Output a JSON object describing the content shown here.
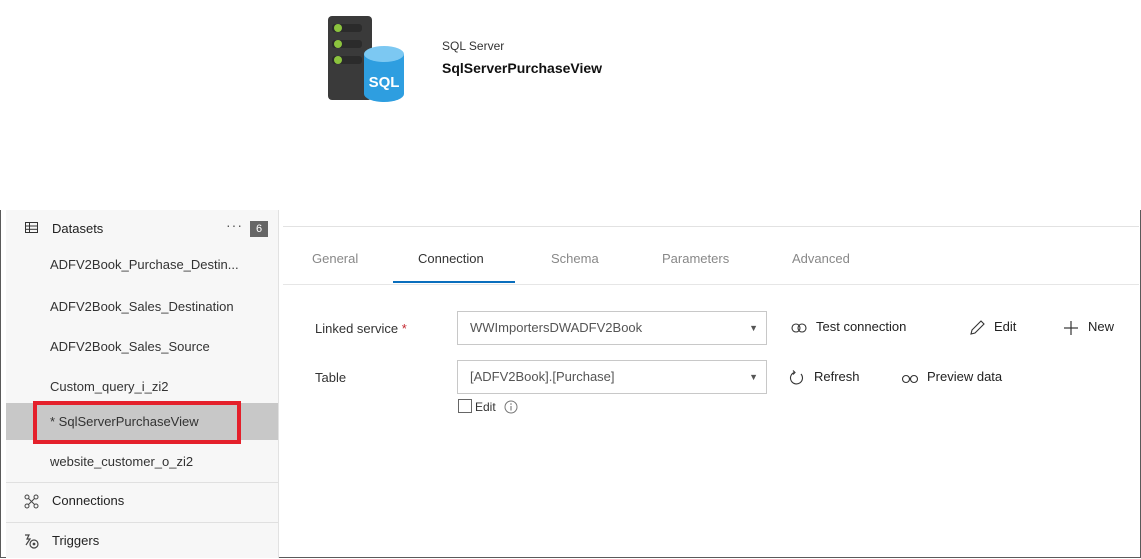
{
  "header": {
    "type_label": "SQL Server",
    "dataset_name": "SqlServerPurchaseView",
    "icon": "sql-server-icon",
    "icon_text": "SQL"
  },
  "sidebar": {
    "section_label": "Datasets",
    "more_label": "···",
    "count": "6",
    "datasets": [
      {
        "label": "ADFV2Book_Purchase_Destin..."
      },
      {
        "label": "ADFV2Book_Sales_Destination"
      },
      {
        "label": "ADFV2Book_Sales_Source"
      },
      {
        "label": "Custom_query_i_zi2"
      },
      {
        "label": "* SqlServerPurchaseView"
      },
      {
        "label": "website_customer_o_zi2"
      }
    ],
    "nav": [
      {
        "label": "Connections",
        "icon": "connections-icon"
      },
      {
        "label": "Triggers",
        "icon": "triggers-icon"
      }
    ]
  },
  "tabs": [
    {
      "label": "General"
    },
    {
      "label": "Connection"
    },
    {
      "label": "Schema"
    },
    {
      "label": "Parameters"
    },
    {
      "label": "Advanced"
    }
  ],
  "active_tab": "Connection",
  "connection": {
    "linked_service_label": "Linked service",
    "required_mark": "*",
    "linked_service_value": "WWImportersDWADFV2Book",
    "test_connection_label": "Test connection",
    "edit_label": "Edit",
    "new_label": "New",
    "table_label": "Table",
    "table_value": "[ADFV2Book].[Purchase]",
    "refresh_label": "Refresh",
    "preview_label": "Preview data",
    "edit_checkbox_label": "Edit",
    "edit_checked": false
  },
  "colors": {
    "accent": "#0a6ebd",
    "highlight": "#e4202b",
    "selected_bg": "#c8c8c8",
    "sql_blue": "#2e9ee0"
  }
}
